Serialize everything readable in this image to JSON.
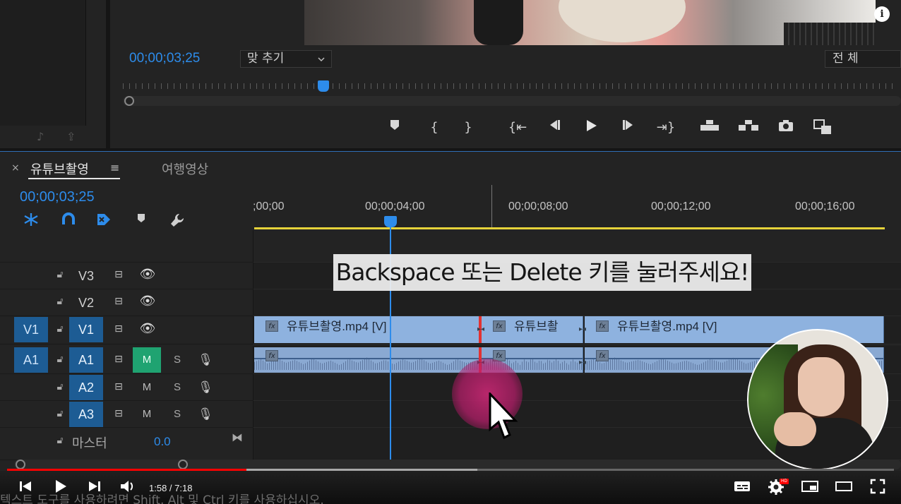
{
  "program_monitor": {
    "timecode": "00;00;03;25",
    "fit_select": "맞 추기",
    "resolution_select": "전 체",
    "info_icon": "i"
  },
  "transport_icons": [
    "marker-icon",
    "mark-in-icon",
    "mark-out-icon",
    "go-to-in-icon",
    "step-back-icon",
    "play-icon",
    "step-forward-icon",
    "go-to-out-icon",
    "lift-icon",
    "extract-icon",
    "export-frame-icon",
    "comparison-view-icon"
  ],
  "timeline": {
    "tabs": [
      {
        "label": "유튜브촬영",
        "active": true
      },
      {
        "label": "여행영상",
        "active": false
      }
    ],
    "close_glyph": "×",
    "menu_glyph": "≡",
    "timecode": "00;00;03;25",
    "ruler_labels": [
      ";00;00",
      "00;00;04;00",
      "00;00;08;00",
      "00;00;12;00",
      "00;00;16;00"
    ],
    "video_tracks": [
      {
        "target": "V3",
        "source": ""
      },
      {
        "target": "V2",
        "source": ""
      },
      {
        "target": "V1",
        "source": "V1"
      }
    ],
    "audio_tracks": [
      {
        "target": "A1",
        "source": "A1",
        "mute": "M",
        "solo": "S",
        "muted": true
      },
      {
        "target": "A2",
        "source": "",
        "mute": "M",
        "solo": "S",
        "muted": false
      },
      {
        "target": "A3",
        "source": "",
        "mute": "M",
        "solo": "S",
        "muted": false
      }
    ],
    "master": {
      "label": "마스터",
      "value": "0.0"
    },
    "clips_v": [
      {
        "label": "유튜브촬영.mp4 [V]"
      },
      {
        "label": "유튜브촬"
      },
      {
        "label": "유튜브촬영.mp4 [V]"
      }
    ],
    "fx_label": "fx"
  },
  "overlay": {
    "caption": "Backspace 또는 Delete 키를 눌러주세요!"
  },
  "player": {
    "time": "1:58 / 7:18",
    "played_fraction": 0.27,
    "buffered_fraction": 0.53,
    "hd_badge": "HD"
  },
  "hint": "텍스트 도구를 사용하려면 Shift, Alt 및 Ctrl 키를 사용하십시오.",
  "colors": {
    "accent": "#2d8ceb",
    "clip_video": "#8eb2df",
    "mute_on": "#1fa371",
    "progress": "#ff0000",
    "click_highlight": "#d2287a",
    "work_area": "#e6d23a"
  }
}
